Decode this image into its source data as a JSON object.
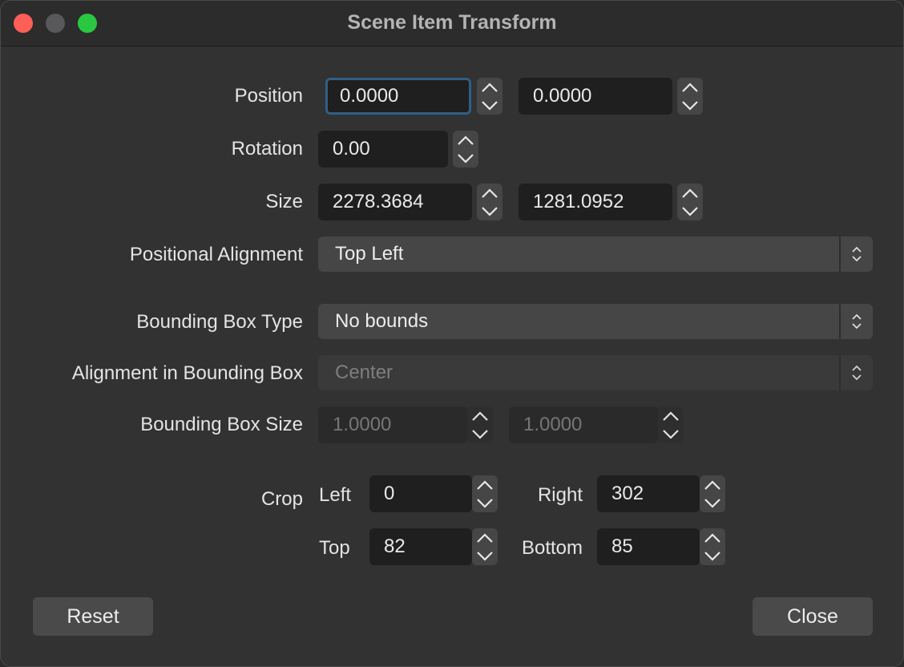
{
  "window": {
    "title": "Scene Item Transform"
  },
  "position": {
    "label": "Position",
    "x": "0.0000",
    "y": "0.0000"
  },
  "rotation": {
    "label": "Rotation",
    "value": "0.00"
  },
  "size": {
    "label": "Size",
    "width": "2278.3684",
    "height": "1281.0952"
  },
  "positional_alignment": {
    "label": "Positional Alignment",
    "value": "Top Left"
  },
  "bounding_box_type": {
    "label": "Bounding Box Type",
    "value": "No bounds"
  },
  "alignment_in_bounding_box": {
    "label": "Alignment in Bounding Box",
    "value": "Center"
  },
  "bounding_box_size": {
    "label": "Bounding Box Size",
    "width": "1.0000",
    "height": "1.0000"
  },
  "crop": {
    "label": "Crop",
    "left_label": "Left",
    "left": "0",
    "right_label": "Right",
    "right": "302",
    "top_label": "Top",
    "top": "82",
    "bottom_label": "Bottom",
    "bottom": "85"
  },
  "buttons": {
    "reset": "Reset",
    "close": "Close"
  },
  "colors": {
    "close": "#fe5f57",
    "minimize": "#58585a",
    "zoom": "#2ac841",
    "focus_ring": "#2f5f86"
  },
  "icons": {
    "spin_up": "chevron-up-icon",
    "spin_down": "chevron-down-icon",
    "combo": "up-down-chevron-icon"
  }
}
